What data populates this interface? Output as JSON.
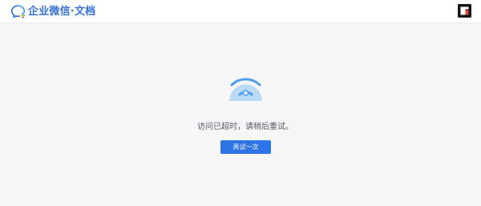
{
  "header": {
    "brand_name": "企业微信·文档",
    "logo_icon": "wecom-chat-bubble-icon",
    "avatar_icon": "user-avatar-icon"
  },
  "error": {
    "illustration_icon": "wifi-signal-icon",
    "message": "访问已超时，请稍后重试。",
    "retry_label": "再试一次"
  },
  "colors": {
    "brand_blue": "#3571d6",
    "button_blue": "#2f74e6",
    "wifi_blue": "#4c9df0",
    "wifi_light": "#bcd9f5",
    "background": "#f7f7f8"
  }
}
